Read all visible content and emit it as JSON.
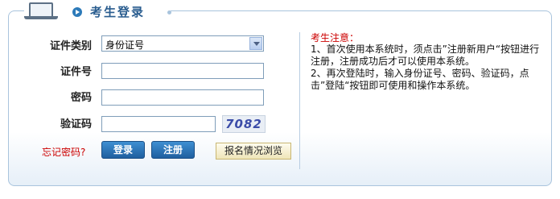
{
  "header": {
    "title": "考生登录"
  },
  "form": {
    "id_type_label": "证件类别",
    "id_type_value": "身份证号",
    "id_number_label": "证件号",
    "password_label": "密码",
    "captcha_label": "验证码",
    "captcha_code": "7082",
    "forgot_password": "忘记密码?",
    "login_button": "登录",
    "register_button": "注册",
    "browse_button": "报名情况浏览"
  },
  "notice": {
    "title": "考生注意：",
    "item1": "1、首次使用本系统时，须点击”注册新用户“按钮进行注册，注册成功后才可以使用本系统。",
    "item2": "2、再次登陆时，输入身份证号、密码、验证码，点击”登陆“按钮即可使用和操作本系统。"
  },
  "colors": {
    "accent": "#2a5d8f",
    "button": "#2f7bbf",
    "warning": "#cc0000"
  }
}
